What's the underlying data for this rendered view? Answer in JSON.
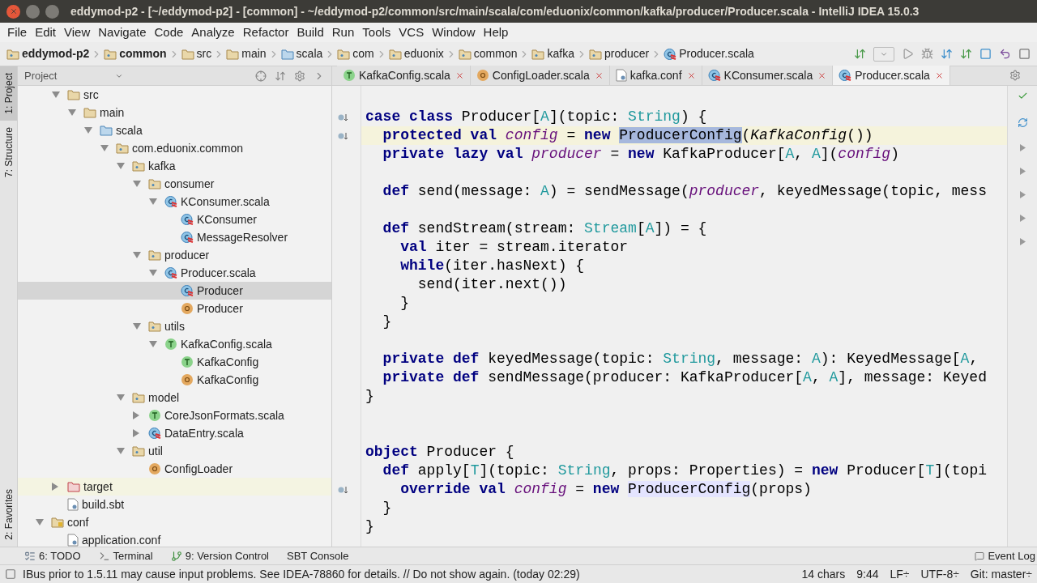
{
  "window": {
    "title": "eddymod-p2 - [~/eddymod-p2] - [common] - ~/eddymod-p2/common/src/main/scala/com/eduonix/common/kafka/producer/Producer.scala - IntelliJ IDEA 15.0.3"
  },
  "menu": [
    "File",
    "Edit",
    "View",
    "Navigate",
    "Code",
    "Analyze",
    "Refactor",
    "Build",
    "Run",
    "Tools",
    "VCS",
    "Window",
    "Help"
  ],
  "breadcrumbs": [
    {
      "label": "eddymod-p2",
      "kind": "module",
      "bold": true
    },
    {
      "label": "common",
      "kind": "module",
      "bold": true
    },
    {
      "label": "src",
      "kind": "folder",
      "bold": false
    },
    {
      "label": "main",
      "kind": "folder",
      "bold": false
    },
    {
      "label": "scala",
      "kind": "source-folder",
      "bold": false
    },
    {
      "label": "com",
      "kind": "package",
      "bold": false
    },
    {
      "label": "eduonix",
      "kind": "package",
      "bold": false
    },
    {
      "label": "common",
      "kind": "package",
      "bold": false
    },
    {
      "label": "kafka",
      "kind": "package",
      "bold": false
    },
    {
      "label": "producer",
      "kind": "package",
      "bold": false
    },
    {
      "label": "Producer.scala",
      "kind": "class",
      "bold": false
    }
  ],
  "side_tabs": [
    {
      "label": "1: Project",
      "selected": true
    },
    {
      "label": "7: Structure",
      "selected": false
    },
    {
      "label": "2: Favorites",
      "selected": false
    }
  ],
  "project_panel": {
    "title": "Project",
    "tree": [
      {
        "children": [
          {
            "label": "src",
            "kind": "folder",
            "expanded": true,
            "selected": false,
            "children": [
              {
                "label": "main",
                "kind": "folder",
                "expanded": true,
                "selected": false,
                "children": [
                  {
                    "label": "scala",
                    "kind": "source-folder",
                    "expanded": true,
                    "selected": false,
                    "children": [
                      {
                        "label": "com.eduonix.common",
                        "kind": "package",
                        "expanded": true,
                        "selected": false,
                        "children": [
                          {
                            "label": "kafka",
                            "kind": "package",
                            "expanded": true,
                            "selected": false,
                            "children": [
                              {
                                "label": "consumer",
                                "kind": "package",
                                "expanded": true,
                                "selected": false,
                                "children": [
                                  {
                                    "label": "KConsumer.scala",
                                    "kind": "class",
                                    "expanded": true,
                                    "selected": false,
                                    "children": [
                                      {
                                        "label": "KConsumer",
                                        "kind": "class",
                                        "selected": false
                                      },
                                      {
                                        "label": "MessageResolver",
                                        "kind": "class",
                                        "selected": false
                                      }
                                    ]
                                  }
                                ]
                              },
                              {
                                "label": "producer",
                                "kind": "package",
                                "expanded": true,
                                "selected": false,
                                "children": [
                                  {
                                    "label": "Producer.scala",
                                    "kind": "class",
                                    "expanded": true,
                                    "selected": false,
                                    "children": [
                                      {
                                        "label": "Producer",
                                        "kind": "class",
                                        "selected": true
                                      },
                                      {
                                        "label": "Producer",
                                        "kind": "object",
                                        "selected": false
                                      }
                                    ]
                                  }
                                ]
                              },
                              {
                                "label": "utils",
                                "kind": "package",
                                "expanded": true,
                                "selected": false,
                                "children": [
                                  {
                                    "label": "KafkaConfig.scala",
                                    "kind": "trait",
                                    "expanded": true,
                                    "selected": false,
                                    "children": [
                                      {
                                        "label": "KafkaConfig",
                                        "kind": "trait",
                                        "selected": false
                                      },
                                      {
                                        "label": "KafkaConfig",
                                        "kind": "object",
                                        "selected": false
                                      }
                                    ]
                                  }
                                ]
                              }
                            ]
                          },
                          {
                            "label": "model",
                            "kind": "package",
                            "expanded": true,
                            "selected": false,
                            "children": [
                              {
                                "label": "CoreJsonFormats.scala",
                                "kind": "trait",
                                "expanded": false,
                                "selected": false
                              },
                              {
                                "label": "DataEntry.scala",
                                "kind": "class",
                                "expanded": false,
                                "selected": false
                              }
                            ]
                          },
                          {
                            "label": "util",
                            "kind": "package",
                            "expanded": true,
                            "selected": false,
                            "children": [
                              {
                                "label": "ConfigLoader",
                                "kind": "object",
                                "selected": false
                              }
                            ]
                          }
                        ]
                      }
                    ]
                  }
                ]
              }
            ]
          },
          {
            "label": "target",
            "kind": "excluded-folder",
            "expanded": false,
            "selected": false,
            "highlighted": true
          },
          {
            "label": "build.sbt",
            "kind": "file",
            "selected": false
          }
        ]
      },
      {
        "label": "conf",
        "kind": "resources-folder",
        "expanded": true,
        "selected": false,
        "children": [
          {
            "label": "application.conf",
            "kind": "file",
            "selected": false
          }
        ]
      }
    ]
  },
  "tabs": [
    {
      "label": "KafkaConfig.scala",
      "kind": "trait",
      "selected": false
    },
    {
      "label": "ConfigLoader.scala",
      "kind": "object",
      "selected": false
    },
    {
      "label": "kafka.conf",
      "kind": "file",
      "selected": false
    },
    {
      "label": "KConsumer.scala",
      "kind": "class",
      "selected": false
    },
    {
      "label": "Producer.scala",
      "kind": "class",
      "selected": true
    }
  ],
  "code": [
    {
      "gutter_icon": true,
      "current": false,
      "tokens": [
        {
          "kind": "kw",
          "text": "case class"
        },
        {
          "kind": "plain",
          "text": " Producer["
        },
        {
          "kind": "type",
          "text": "A"
        },
        {
          "kind": "plain",
          "text": "](topic: "
        },
        {
          "kind": "type",
          "text": "String"
        },
        {
          "kind": "plain",
          "text": ") {"
        }
      ]
    },
    {
      "gutter_icon": true,
      "current": true,
      "tokens": [
        {
          "kind": "kw",
          "text": "  protected val "
        },
        {
          "kind": "field",
          "text": "config"
        },
        {
          "kind": "plain",
          "text": " = "
        },
        {
          "kind": "kw",
          "text": "new "
        },
        {
          "kind": "sel",
          "text": "ProducerConfig"
        },
        {
          "kind": "plain",
          "text": "("
        },
        {
          "kind": "italic",
          "text": "KafkaConfig"
        },
        {
          "kind": "plain",
          "text": "())"
        }
      ]
    },
    {
      "gutter_icon": false,
      "current": false,
      "tokens": [
        {
          "kind": "kw",
          "text": "  private lazy val "
        },
        {
          "kind": "field",
          "text": "producer"
        },
        {
          "kind": "plain",
          "text": " = "
        },
        {
          "kind": "kw",
          "text": "new"
        },
        {
          "kind": "plain",
          "text": " KafkaProducer["
        },
        {
          "kind": "type",
          "text": "A"
        },
        {
          "kind": "plain",
          "text": ", "
        },
        {
          "kind": "type",
          "text": "A"
        },
        {
          "kind": "plain",
          "text": "]("
        },
        {
          "kind": "field",
          "text": "config"
        },
        {
          "kind": "plain",
          "text": ")"
        }
      ]
    },
    {
      "gutter_icon": false,
      "current": false
    },
    {
      "gutter_icon": false,
      "current": false,
      "tokens": [
        {
          "kind": "kw",
          "text": "  def"
        },
        {
          "kind": "plain",
          "text": " send(message: "
        },
        {
          "kind": "type",
          "text": "A"
        },
        {
          "kind": "plain",
          "text": ") = sendMessage("
        },
        {
          "kind": "field",
          "text": "producer"
        },
        {
          "kind": "plain",
          "text": ", keyedMessage(topic, mess"
        }
      ]
    },
    {
      "gutter_icon": false,
      "current": false
    },
    {
      "gutter_icon": false,
      "current": false,
      "tokens": [
        {
          "kind": "kw",
          "text": "  def"
        },
        {
          "kind": "plain",
          "text": " sendStream(stream: "
        },
        {
          "kind": "type",
          "text": "Stream"
        },
        {
          "kind": "plain",
          "text": "["
        },
        {
          "kind": "type",
          "text": "A"
        },
        {
          "kind": "plain",
          "text": "]) = {"
        }
      ]
    },
    {
      "gutter_icon": false,
      "current": false,
      "tokens": [
        {
          "kind": "kw",
          "text": "    val"
        },
        {
          "kind": "plain",
          "text": " iter = stream.iterator"
        }
      ]
    },
    {
      "gutter_icon": false,
      "current": false,
      "tokens": [
        {
          "kind": "kw",
          "text": "    while"
        },
        {
          "kind": "plain",
          "text": "(iter.hasNext) {"
        }
      ]
    },
    {
      "gutter_icon": false,
      "current": false,
      "tokens": [
        {
          "kind": "plain",
          "text": "      send(iter.next())"
        }
      ]
    },
    {
      "gutter_icon": false,
      "current": false,
      "tokens": [
        {
          "kind": "plain",
          "text": "    }"
        }
      ]
    },
    {
      "gutter_icon": false,
      "current": false,
      "tokens": [
        {
          "kind": "plain",
          "text": "  }"
        }
      ]
    },
    {
      "gutter_icon": false,
      "current": false
    },
    {
      "gutter_icon": false,
      "current": false,
      "tokens": [
        {
          "kind": "kw",
          "text": "  private def"
        },
        {
          "kind": "plain",
          "text": " keyedMessage(topic: "
        },
        {
          "kind": "type",
          "text": "String"
        },
        {
          "kind": "plain",
          "text": ", message: "
        },
        {
          "kind": "type",
          "text": "A"
        },
        {
          "kind": "plain",
          "text": "): KeyedMessage["
        },
        {
          "kind": "type",
          "text": "A"
        },
        {
          "kind": "plain",
          "text": ","
        }
      ]
    },
    {
      "gutter_icon": false,
      "current": false,
      "tokens": [
        {
          "kind": "kw",
          "text": "  private def"
        },
        {
          "kind": "plain",
          "text": " sendMessage(producer: KafkaProducer["
        },
        {
          "kind": "type",
          "text": "A"
        },
        {
          "kind": "plain",
          "text": ", "
        },
        {
          "kind": "type",
          "text": "A"
        },
        {
          "kind": "plain",
          "text": "], message: Keyed"
        }
      ]
    },
    {
      "gutter_icon": false,
      "current": false,
      "tokens": [
        {
          "kind": "plain",
          "text": "}"
        }
      ]
    },
    {
      "gutter_icon": false,
      "current": false
    },
    {
      "gutter_icon": false,
      "current": false
    },
    {
      "gutter_icon": false,
      "current": false,
      "tokens": [
        {
          "kind": "kw",
          "text": "object"
        },
        {
          "kind": "plain",
          "text": " Producer {"
        }
      ]
    },
    {
      "gutter_icon": false,
      "current": false,
      "tokens": [
        {
          "kind": "kw",
          "text": "  def"
        },
        {
          "kind": "plain",
          "text": " apply["
        },
        {
          "kind": "type",
          "text": "T"
        },
        {
          "kind": "plain",
          "text": "](topic: "
        },
        {
          "kind": "type",
          "text": "String"
        },
        {
          "kind": "plain",
          "text": ", props: Properties) = "
        },
        {
          "kind": "kw",
          "text": "new"
        },
        {
          "kind": "plain",
          "text": " Producer["
        },
        {
          "kind": "type",
          "text": "T"
        },
        {
          "kind": "plain",
          "text": "](topi"
        }
      ]
    },
    {
      "gutter_icon": true,
      "current": false,
      "tokens": [
        {
          "kind": "kw",
          "text": "    override val "
        },
        {
          "kind": "field",
          "text": "config"
        },
        {
          "kind": "plain",
          "text": " = "
        },
        {
          "kind": "kw",
          "text": "new "
        },
        {
          "kind": "usage",
          "text": "ProducerConfig"
        },
        {
          "kind": "plain",
          "text": "(props)"
        }
      ]
    },
    {
      "gutter_icon": false,
      "current": false,
      "tokens": [
        {
          "kind": "plain",
          "text": "  }"
        }
      ]
    },
    {
      "gutter_icon": false,
      "current": false,
      "tokens": [
        {
          "kind": "plain",
          "text": "}"
        }
      ]
    }
  ],
  "tool_windows": [
    {
      "label": "6: TODO",
      "kind": "todo"
    },
    {
      "label": "Terminal",
      "kind": "terminal"
    },
    {
      "label": "9: Version Control",
      "kind": "vcs"
    },
    {
      "label": "SBT Console",
      "kind": "plain"
    }
  ],
  "event_log": "Event Log",
  "status_bar": {
    "message": "IBus prior to 1.5.11 may cause input problems. See IDEA-78860 for details. // Do not show again. (today 02:29)",
    "items": [
      "14 chars",
      "9:44",
      "LF÷",
      "UTF-8÷",
      "Git: master÷"
    ]
  }
}
